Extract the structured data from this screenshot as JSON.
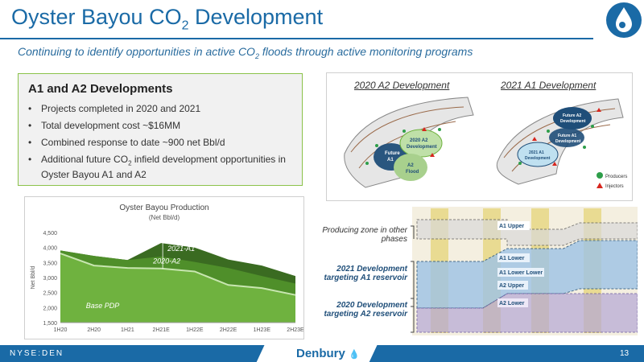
{
  "header": {
    "title_main": "Oyster Bayou CO",
    "title_sub": "2",
    "title_end": " Development",
    "subtitle_a": "Continuing to identify opportunities in active CO",
    "subtitle_sub": "2",
    "subtitle_b": " floods through active monitoring programs"
  },
  "developments": {
    "heading": "A1 and A2 Developments",
    "items": [
      "Projects completed in 2020 and 2021",
      "Total development cost ~$16MM",
      "Combined response to date ~900 net Bbl/d"
    ],
    "item4_a": "Additional future CO",
    "item4_sub": "2",
    "item4_b": " infield development opportunities in Oyster Bayou A1 and A2"
  },
  "maps": {
    "caption_left": "2020 A2 Development",
    "caption_right": "2021 A1 Development",
    "left_labels": {
      "future": "Future",
      "a1": "A1",
      "a2dev1": "2020 A2",
      "a2dev2": "Development",
      "flood1": "A2",
      "flood2": "Flood"
    },
    "right_labels": {
      "fa2a": "Future A2",
      "fa2b": "Development",
      "fa1a": "Future A1",
      "fa1b": "Development",
      "a1a": "2021 A1",
      "a1b": "Development"
    },
    "legend": {
      "producers": "Producers",
      "injectors": "Injectors"
    },
    "colors": {
      "producer": "#2e9e4a",
      "injector": "#d7261e",
      "dev_fill": "#1f4e79",
      "flood_fill": "#a8d08d"
    }
  },
  "logs": {
    "annot_producing": "Producing zone in other phases",
    "annot_2021": "2021 Development targeting A1 reservoir",
    "annot_2020": "2020 Development targeting A2 reservoir",
    "zones": [
      "A1 Upper",
      "A1 Lower",
      "A1 Lower Lower",
      "A2 Upper",
      "A2 Lower"
    ]
  },
  "chart_data": {
    "type": "area",
    "title": "Oyster Bayou Production",
    "subtitle": "(Net Bbl/d)",
    "ylabel": "Net Bbl/d",
    "xlabel": "",
    "categories": [
      "1H20",
      "2H20",
      "1H21",
      "2H21E",
      "1H22E",
      "2H22E",
      "1H23E",
      "2H23E"
    ],
    "ylim": [
      1500,
      4500
    ],
    "yticks": [
      1500,
      2000,
      2500,
      3000,
      3500,
      4000,
      4500
    ],
    "ytick_labels": [
      "1,500",
      "2,000",
      "2,500",
      "3,000",
      "3,500",
      "4,000",
      "4,500"
    ],
    "stacking": "cumulative",
    "series": [
      {
        "name": "Base PDP",
        "color": "#6fb23f",
        "values": [
          3800,
          3400,
          3320,
          3300,
          3200,
          2750,
          2650,
          2420
        ]
      },
      {
        "name": "2020-A2",
        "color": "#4f8f2a",
        "values": [
          3900,
          3720,
          3580,
          3700,
          3520,
          3320,
          3050,
          2800
        ]
      },
      {
        "name": "2021-A1",
        "color": "#3a6b21",
        "values": [
          3900,
          3720,
          3580,
          4150,
          4000,
          3600,
          3400,
          3050
        ]
      }
    ],
    "grid": false,
    "legend": "inline"
  },
  "footer": {
    "exchange": "NYSE:DEN",
    "brand": "Denbury",
    "page": "13",
    "bar_color": "#1a6aa6"
  }
}
